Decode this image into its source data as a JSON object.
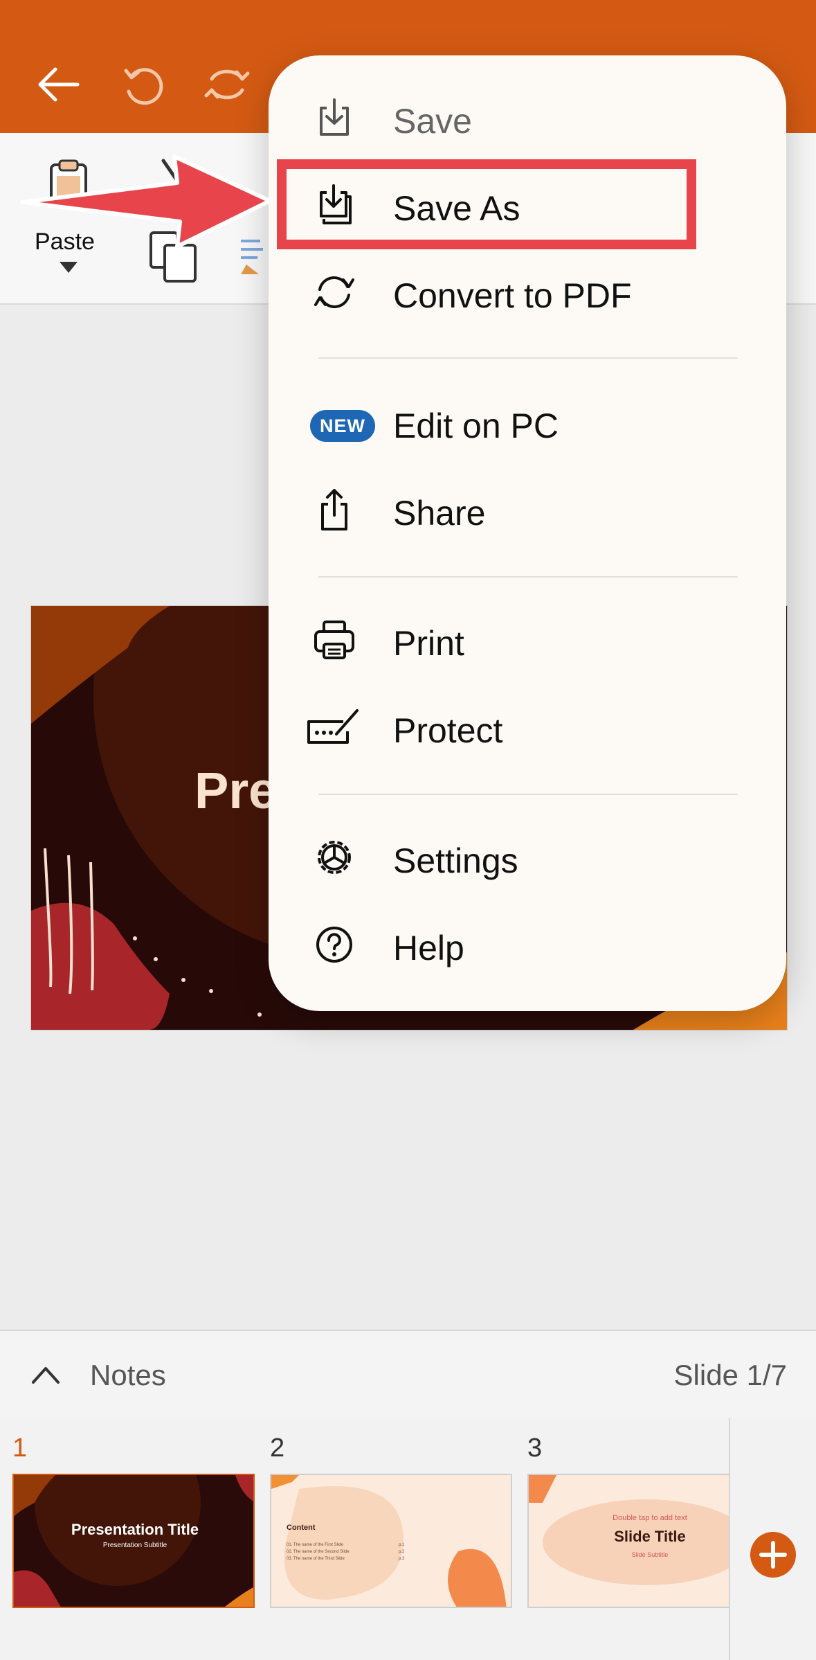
{
  "colors": {
    "accent": "#d45a13",
    "highlight": "#e8444b",
    "arrow": "#e8444b",
    "badge": "#1d67b4"
  },
  "toolbar": {
    "icons": [
      "back-arrow-icon",
      "undo-icon",
      "redo-icon"
    ]
  },
  "ribbon": {
    "paste_label": "Paste"
  },
  "slide": {
    "title_fragment": "Pre"
  },
  "menu": {
    "items": [
      {
        "id": "save",
        "label": "Save",
        "icon": "save-icon"
      },
      {
        "id": "save-as",
        "label": "Save As",
        "icon": "save-as-icon"
      },
      {
        "id": "convert-pdf",
        "label": "Convert to PDF",
        "icon": "convert-icon"
      },
      {
        "id": "edit-on-pc",
        "label": "Edit on PC",
        "badge": "NEW"
      },
      {
        "id": "share",
        "label": "Share",
        "icon": "share-icon"
      },
      {
        "id": "print",
        "label": "Print",
        "icon": "print-icon"
      },
      {
        "id": "protect",
        "label": "Protect",
        "icon": "protect-icon"
      },
      {
        "id": "settings",
        "label": "Settings",
        "icon": "settings-icon"
      },
      {
        "id": "help",
        "label": "Help",
        "icon": "help-icon"
      }
    ]
  },
  "notes": {
    "label": "Notes",
    "slide_counter": "Slide 1/7"
  },
  "thumbnails": [
    {
      "number": "1",
      "title": "Presentation Title",
      "subtitle": "Presentation Subtitle"
    },
    {
      "number": "2",
      "heading": "Content",
      "lines": [
        "01. The name of the First Slide",
        "02. The name of the Second Slide",
        "03. The name of the Third Slide"
      ],
      "page_refs": [
        "p.1",
        "p.2",
        "p.3"
      ]
    },
    {
      "number": "3",
      "hint": "Double tap to add text",
      "title": "Slide Title",
      "subtitle": "Slide Subtitle"
    }
  ]
}
